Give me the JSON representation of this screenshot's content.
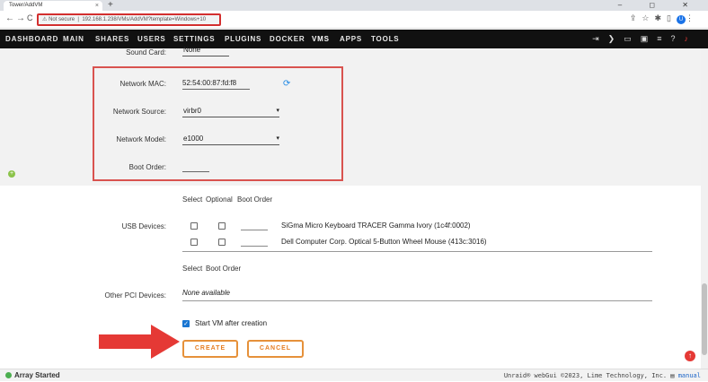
{
  "browser": {
    "tab_title": "Tower/AddVM",
    "tab_close": "×",
    "new_tab": "+",
    "window_controls": "– ◻ ✕",
    "nav_back": "←",
    "nav_forward": "→",
    "nav_reload": "C",
    "security_label": "Not secure",
    "url": "192.168.1.238/VMs/AddVM?template=Windows+10",
    "profile_initial": "U",
    "toolbar_icons": [
      "share-icon",
      "star-icon",
      "extensions-icon",
      "sidebar-icon",
      "profile-icon",
      "kebab-menu-icon"
    ]
  },
  "menu": {
    "items": [
      "DASHBOARD",
      "MAIN",
      "SHARES",
      "USERS",
      "SETTINGS",
      "PLUGINS",
      "DOCKER",
      "VMS",
      "APPS",
      "TOOLS"
    ],
    "active": "VMS",
    "right_icons": [
      "logout-icon",
      "terminal-icon",
      "feedback-icon",
      "monitor-icon",
      "log-icon",
      "help-icon",
      "bell-icon"
    ]
  },
  "form": {
    "sound_card": {
      "label": "Sound Card:",
      "value": "None"
    },
    "network_mac": {
      "label": "Network MAC:",
      "value": "52:54:00:87:fd:f8"
    },
    "network_source": {
      "label": "Network Source:",
      "value": "virbr0"
    },
    "network_model": {
      "label": "Network Model:",
      "value": "e1000"
    },
    "boot_order": {
      "label": "Boot Order:",
      "value": ""
    },
    "usb": {
      "headers": {
        "select": "Select",
        "optional": "Optional",
        "boot_order": "Boot Order"
      },
      "label": "USB Devices:",
      "devices": [
        {
          "name": "SiGma Micro Keyboard TRACER Gamma Ivory (1c4f:0002)",
          "select": false,
          "optional": false
        },
        {
          "name": "Dell Computer Corp. Optical 5-Button Wheel Mouse (413c:3016)",
          "select": false,
          "optional": false
        }
      ]
    },
    "pci": {
      "headers": {
        "select": "Select",
        "boot_order": "Boot Order"
      },
      "label": "Other PCI Devices:",
      "value": "None available"
    },
    "start_vm": {
      "label": "Start VM after creation",
      "checked": true
    },
    "create_label": "CREATE",
    "cancel_label": "CANCEL"
  },
  "status": {
    "array": "Array Started",
    "footer": "Unraid® webGui ©2023, Lime Technology, Inc.",
    "manual": "manual"
  },
  "colors": {
    "highlight_red": "#d9534f",
    "button_orange": "#e6913a",
    "arrow_red": "#e53935",
    "menu_bg": "#111111"
  }
}
